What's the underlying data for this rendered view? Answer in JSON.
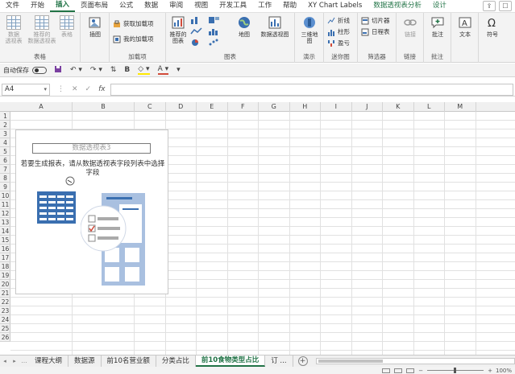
{
  "ribbon_tabs": [
    "文件",
    "开始",
    "插入",
    "页面布局",
    "公式",
    "数据",
    "审阅",
    "视图",
    "开发工具",
    "工作",
    "帮助",
    "XY Chart Labels",
    "数据透视表分析",
    "设计"
  ],
  "active_tab": "插入",
  "ribbon": {
    "tables": {
      "label": "表格",
      "pivot": "数据\n透视表",
      "recommended_pivot": "推荐的\n数据透视表",
      "table": "表格"
    },
    "illustrations": {
      "label": "插图"
    },
    "addins": {
      "label": "加载项",
      "get": "获取加载项",
      "my": "我的加载项"
    },
    "charts": {
      "label": "图表",
      "recommended": "推荐的\n图表",
      "maps": "地图",
      "pivotchart": "数据透视图"
    },
    "tours": {
      "label": "演示",
      "map3d": "三维地\n图"
    },
    "sparklines": {
      "label": "迷你图",
      "line": "折线",
      "column": "柱形",
      "winloss": "盈亏"
    },
    "filters": {
      "label": "筛选器",
      "slicer": "切片器",
      "timeline": "日程表"
    },
    "links": {
      "label": "链接",
      "link": "链接"
    },
    "comments": {
      "label": "批注",
      "comment": "批注"
    },
    "text": {
      "label": "文本"
    },
    "symbols": {
      "label": "符号"
    }
  },
  "qat": {
    "autosave": "自动保存",
    "font_b": "B",
    "font_a": "A"
  },
  "formula_bar": {
    "name_box": "A4",
    "fx": "fx",
    "value": ""
  },
  "columns": [
    "A",
    "B",
    "C",
    "D",
    "E",
    "F",
    "G",
    "H",
    "I",
    "J",
    "K",
    "L",
    "M"
  ],
  "rows": [
    "1",
    "2",
    "3",
    "4",
    "5",
    "6",
    "7",
    "8",
    "9",
    "10",
    "11",
    "12",
    "13",
    "14",
    "15",
    "16",
    "17",
    "18",
    "19",
    "20",
    "21",
    "22",
    "23",
    "24",
    "25",
    "26"
  ],
  "pivot": {
    "title": "数据透视表3",
    "message": "若要生成报表，请从数据透视表字段列表中选择字段"
  },
  "sheet_tabs": [
    "课程大纲",
    "数据源",
    "前10名营业额",
    "分类占比",
    "前10食物类型占比",
    "订 ..."
  ],
  "active_sheet_index": 4,
  "status": {
    "zoom": "100%"
  },
  "colors": {
    "accent": "#217346",
    "illustration_blue": "#3a6fb0"
  }
}
